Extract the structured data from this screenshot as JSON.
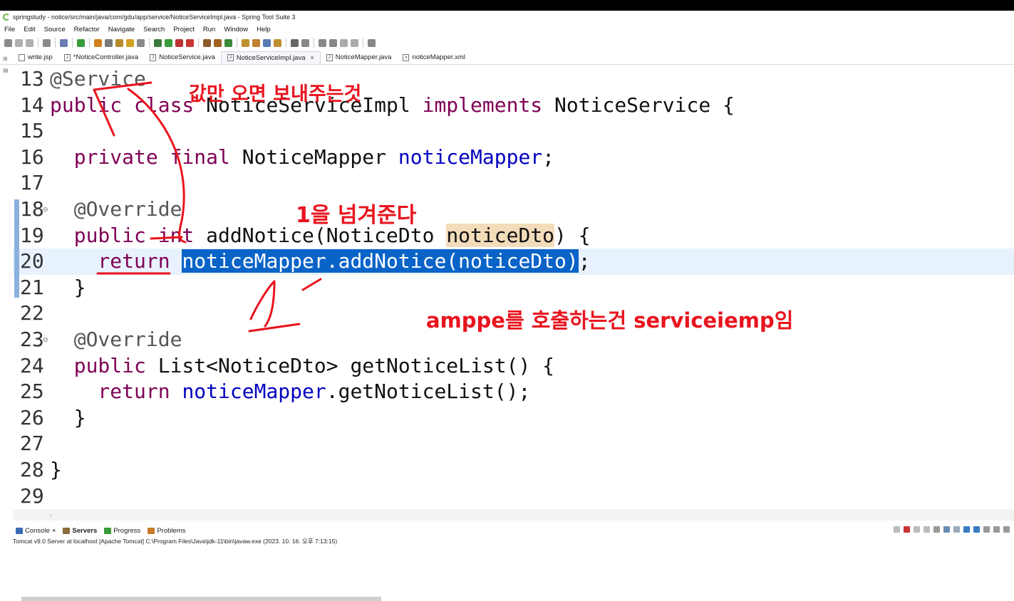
{
  "window": {
    "title": "springstudy - notice/src/main/java/com/gdu/app/service/NoticeServiceImpl.java - Spring Tool Suite 3"
  },
  "menu": [
    "File",
    "Edit",
    "Source",
    "Refactor",
    "Navigate",
    "Search",
    "Project",
    "Run",
    "Window",
    "Help"
  ],
  "tabs": [
    {
      "label": "write.jsp",
      "icon": "jsp-file-icon",
      "active": false
    },
    {
      "label": "*NoticeController.java",
      "icon": "java-file-icon",
      "active": false
    },
    {
      "label": "NoticeService.java",
      "icon": "java-file-icon",
      "active": false
    },
    {
      "label": "NoticeServiceImpl.java",
      "icon": "java-file-icon",
      "active": true
    },
    {
      "label": "NoticeMapper.java",
      "icon": "java-file-icon",
      "active": false
    },
    {
      "label": "noticeMapper.xml",
      "icon": "xml-file-icon",
      "active": false
    }
  ],
  "editor": {
    "lines": [
      {
        "num": "13",
        "code": [
          {
            "t": "@Service",
            "c": "ann"
          }
        ]
      },
      {
        "num": "14",
        "code": [
          {
            "t": "public class ",
            "c": "kw"
          },
          {
            "t": "NoticeServiceImpl ",
            "c": ""
          },
          {
            "t": "implements ",
            "c": "kw"
          },
          {
            "t": "NoticeService {",
            "c": ""
          }
        ]
      },
      {
        "num": "15",
        "code": []
      },
      {
        "num": "16",
        "code": [
          {
            "t": "  private final ",
            "c": "kw"
          },
          {
            "t": "NoticeMapper ",
            "c": ""
          },
          {
            "t": "noticeMapper",
            "c": "fld"
          },
          {
            "t": ";",
            "c": ""
          }
        ]
      },
      {
        "num": "17",
        "code": []
      },
      {
        "num": "18",
        "code": [
          {
            "t": "  @Override",
            "c": "ann"
          }
        ],
        "fold": true
      },
      {
        "num": "19",
        "code": [
          {
            "t": "  public int ",
            "c": "kw"
          },
          {
            "t": "addNotice(NoticeDto ",
            "c": ""
          },
          {
            "t": "noticeDto",
            "c": "param-hl"
          },
          {
            "t": ") {",
            "c": ""
          }
        ]
      },
      {
        "num": "20",
        "code": [
          {
            "t": "    return ",
            "c": "kw"
          },
          {
            "t": "noticeMapper.addNotice(noticeDto)",
            "c": "sel"
          },
          {
            "t": ";",
            "c": ""
          }
        ],
        "current": true
      },
      {
        "num": "21",
        "code": [
          {
            "t": "  }",
            "c": ""
          }
        ]
      },
      {
        "num": "22",
        "code": []
      },
      {
        "num": "23",
        "code": [
          {
            "t": "  @Override",
            "c": "ann"
          }
        ],
        "fold": true
      },
      {
        "num": "24",
        "code": [
          {
            "t": "  public ",
            "c": "kw"
          },
          {
            "t": "List<NoticeDto> getNoticeList() {",
            "c": ""
          }
        ]
      },
      {
        "num": "25",
        "code": [
          {
            "t": "    return ",
            "c": "kw"
          },
          {
            "t": "noticeMapper",
            "c": "fld"
          },
          {
            "t": ".getNoticeList();",
            "c": ""
          }
        ]
      },
      {
        "num": "26",
        "code": [
          {
            "t": "  }",
            "c": ""
          }
        ]
      },
      {
        "num": "27",
        "code": []
      },
      {
        "num": "28",
        "code": [
          {
            "t": "}",
            "c": ""
          }
        ]
      },
      {
        "num": "29",
        "code": []
      }
    ]
  },
  "annotations": {
    "text1": "값만 오면 보내주는것",
    "text2": "1을 넘겨준다",
    "text3": "amppe를 호출하는건 serviceiemp임",
    "color": "#e8141e"
  },
  "bottom_panel": {
    "tabs": [
      {
        "label": "Console",
        "icon": "console-icon",
        "closable": true
      },
      {
        "label": "Servers",
        "icon": "servers-icon",
        "bold": true
      },
      {
        "label": "Progress",
        "icon": "progress-icon"
      },
      {
        "label": "Problems",
        "icon": "problems-icon"
      }
    ],
    "status": "Tomcat v9.0 Server at localhost [Apache Tomcat] C:\\Program Files\\Java\\jdk-11\\bin\\javaw.exe  (2023. 10. 16. 오후 7:13:15)"
  },
  "colors": {
    "keyword": "#7f0055",
    "field": "#0000c0",
    "selection": "#0a64c8",
    "current_line": "#e8f2fe",
    "param_highlight": "#f3dcba"
  }
}
